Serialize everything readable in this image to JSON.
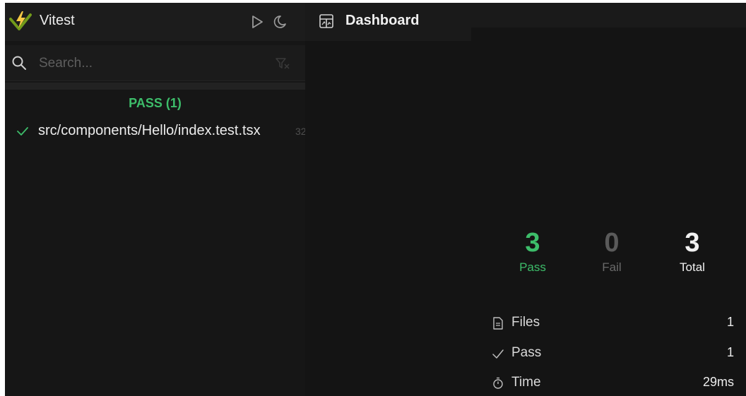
{
  "sidebar": {
    "app_title": "Vitest",
    "search": {
      "placeholder": "Search...",
      "value": ""
    },
    "groups": [
      {
        "title": "PASS (1)",
        "files": [
          {
            "name": "src/components/Hello/index.test.tsx",
            "duration": "32"
          }
        ]
      }
    ]
  },
  "main": {
    "title": "Dashboard",
    "stats": [
      {
        "value": "3",
        "label": "Pass",
        "color": "#3dbd6a"
      },
      {
        "value": "0",
        "label": "Fail",
        "color": "#5a5a5a"
      },
      {
        "value": "3",
        "label": "Total",
        "color": "#f0f0f0"
      }
    ],
    "summary": [
      {
        "icon": "file-icon",
        "label": "Files",
        "value": "1"
      },
      {
        "icon": "check-icon",
        "label": "Pass",
        "value": "1"
      },
      {
        "icon": "stopwatch-icon",
        "label": "Time",
        "value": "29ms"
      }
    ]
  },
  "colors": {
    "accent_green": "#3dbd6a",
    "logo_yellow": "#f6c945",
    "logo_green": "#729b1b",
    "background": "#141414"
  }
}
